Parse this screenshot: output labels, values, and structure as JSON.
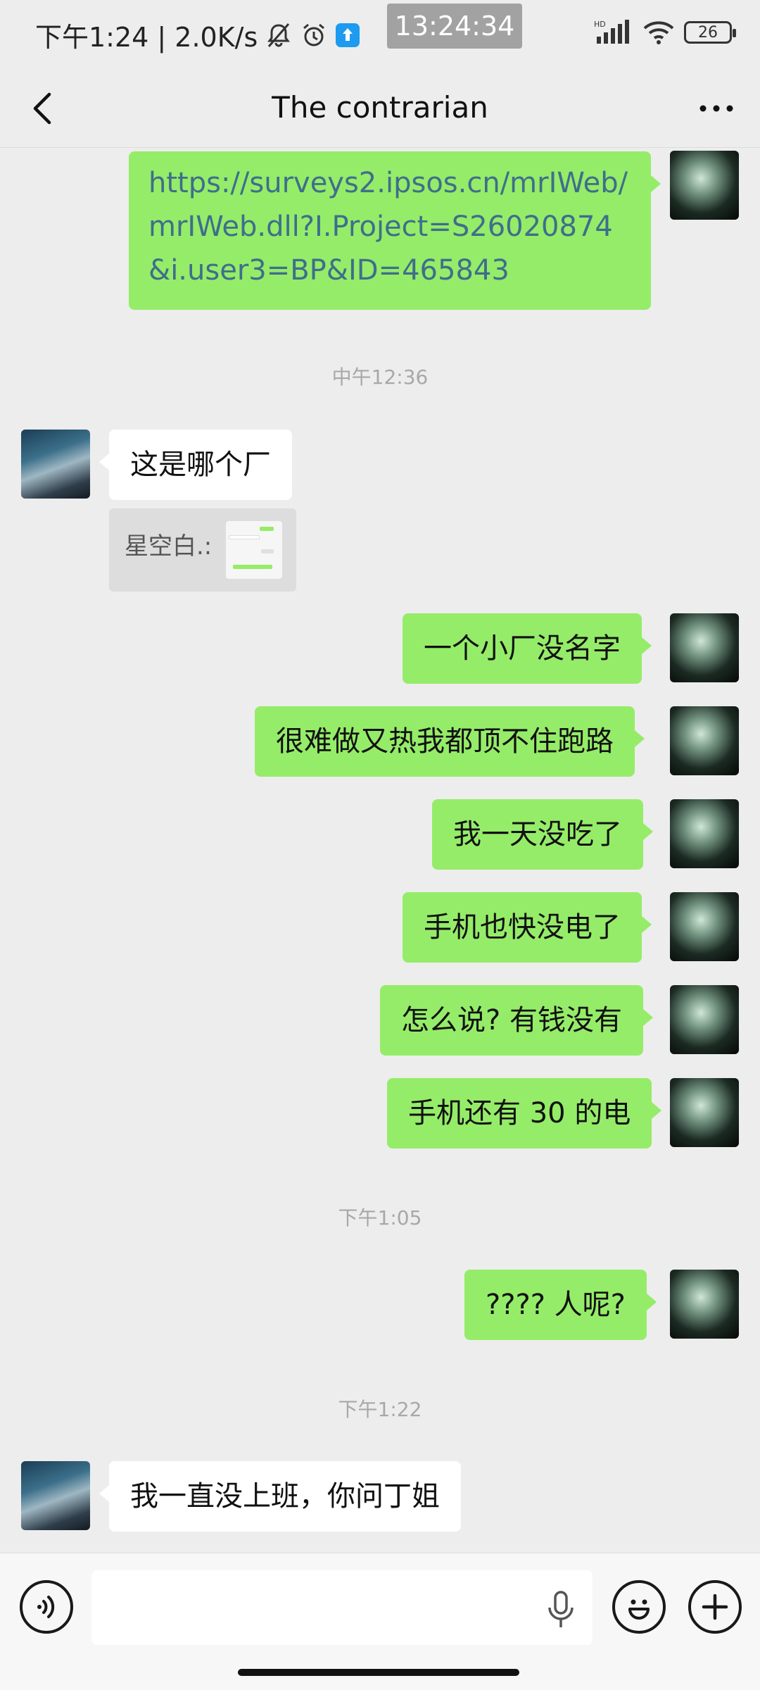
{
  "status_bar": {
    "time": "下午1:24 | 2.0K/s",
    "screenshot_time": "13:24:34",
    "network": "HD",
    "battery": "26"
  },
  "header": {
    "title": "The contrarian"
  },
  "messages": [
    {
      "side": "me",
      "text": "https://surveys2.ipsos.cn/mrIWeb/mrIWeb.dll?I.Project=S26020874&i.user3=BP&ID=465843"
    },
    {
      "type": "timestamp",
      "text": "中午12:36"
    },
    {
      "side": "other",
      "text": "这是哪个厂"
    },
    {
      "type": "quote",
      "text": "星空白.:"
    },
    {
      "side": "me",
      "text": "一个小厂没名字"
    },
    {
      "side": "me",
      "text": "很难做又热我都顶不住跑路"
    },
    {
      "side": "me",
      "text": "我一天没吃了"
    },
    {
      "side": "me",
      "text": "手机也快没电了"
    },
    {
      "side": "me",
      "text": "怎么说? 有钱没有"
    },
    {
      "side": "me",
      "text": "手机还有 30 的电"
    },
    {
      "type": "timestamp",
      "text": "下午1:05"
    },
    {
      "side": "me",
      "text": "???? 人呢?"
    },
    {
      "type": "timestamp",
      "text": "下午1:22"
    },
    {
      "side": "other",
      "text": "我一直没上班，你问丁姐"
    }
  ],
  "input": {
    "value": ""
  },
  "colors": {
    "my_bubble": "#95ec69",
    "their_bubble": "#ffffff",
    "background": "#ededed",
    "link": "#3f6e8b"
  },
  "icons": [
    "mute-bell-icon",
    "alarm-icon",
    "upload-badge-icon",
    "signal-icon",
    "wifi-icon",
    "battery-icon",
    "back-arrow-icon",
    "more-dots-icon",
    "voice-icon",
    "microphone-icon",
    "emoji-icon",
    "plus-icon"
  ]
}
